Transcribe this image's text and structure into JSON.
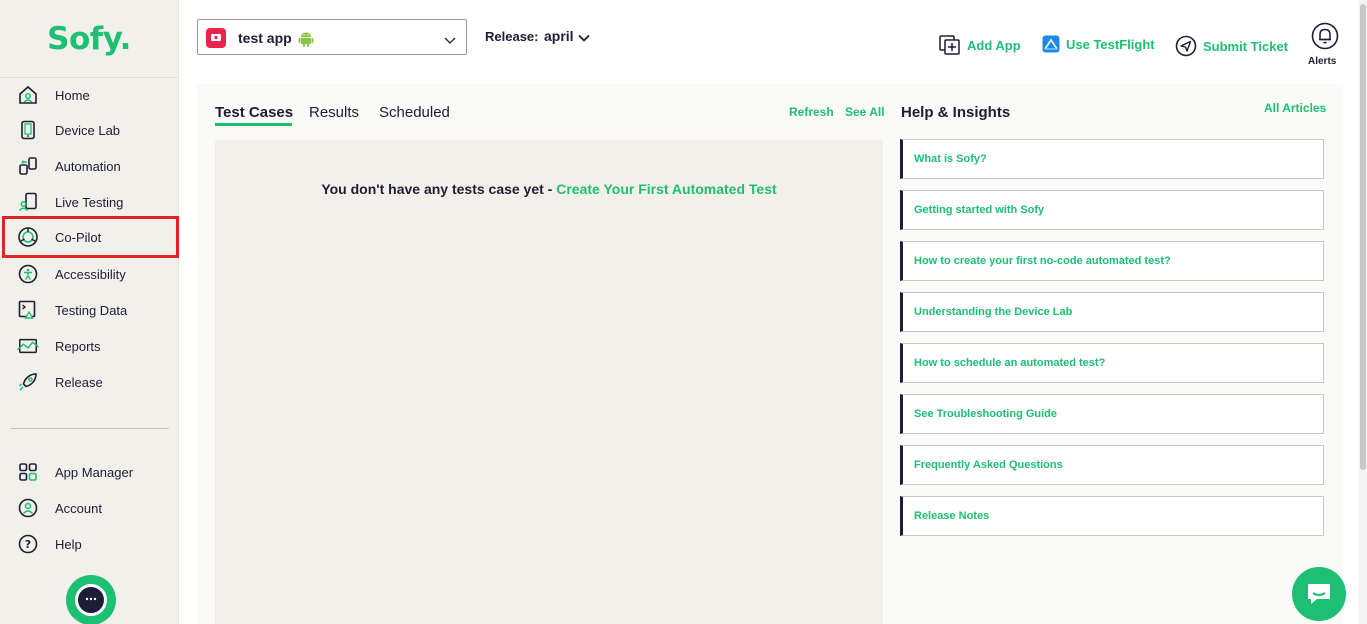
{
  "brand": {
    "logo": "Sofy.",
    "accent": "#1dbf73",
    "dark": "#1d1d35"
  },
  "sidebar": {
    "items": [
      {
        "label": "Home",
        "icon": "home-icon"
      },
      {
        "label": "Device Lab",
        "icon": "device-icon"
      },
      {
        "label": "Automation",
        "icon": "automation-icon"
      },
      {
        "label": "Live Testing",
        "icon": "live-testing-icon"
      },
      {
        "label": "Co-Pilot",
        "icon": "copilot-icon"
      },
      {
        "label": "Accessibility",
        "icon": "accessibility-icon"
      },
      {
        "label": "Testing Data",
        "icon": "testing-data-icon"
      },
      {
        "label": "Reports",
        "icon": "reports-icon"
      },
      {
        "label": "Release",
        "icon": "rocket-icon"
      }
    ],
    "bottom_items": [
      {
        "label": "App Manager",
        "icon": "app-manager-icon"
      },
      {
        "label": "Account",
        "icon": "account-icon"
      },
      {
        "label": "Help",
        "icon": "help-icon"
      }
    ]
  },
  "topbar": {
    "app_name": "test app",
    "release_label": "Release:",
    "release_value": "april",
    "actions": [
      "Add App",
      "Use TestFlight",
      "Submit Ticket"
    ],
    "alerts_label": "Alerts"
  },
  "main": {
    "tabs": [
      "Test Cases",
      "Results",
      "Scheduled"
    ],
    "refresh": "Refresh",
    "see_all": "See All",
    "empty_text": "You don't have any tests case yet - ",
    "empty_link": "Create Your First Automated Test"
  },
  "help": {
    "title": "Help & Insights",
    "all_articles": "All Articles",
    "articles": [
      "What is Sofy?",
      "Getting started with Sofy",
      "How to create your first no-code automated test?",
      "Understanding the Device Lab",
      "How to schedule an automated test?",
      "See Troubleshooting Guide",
      "Frequently Asked Questions",
      "Release Notes"
    ]
  }
}
